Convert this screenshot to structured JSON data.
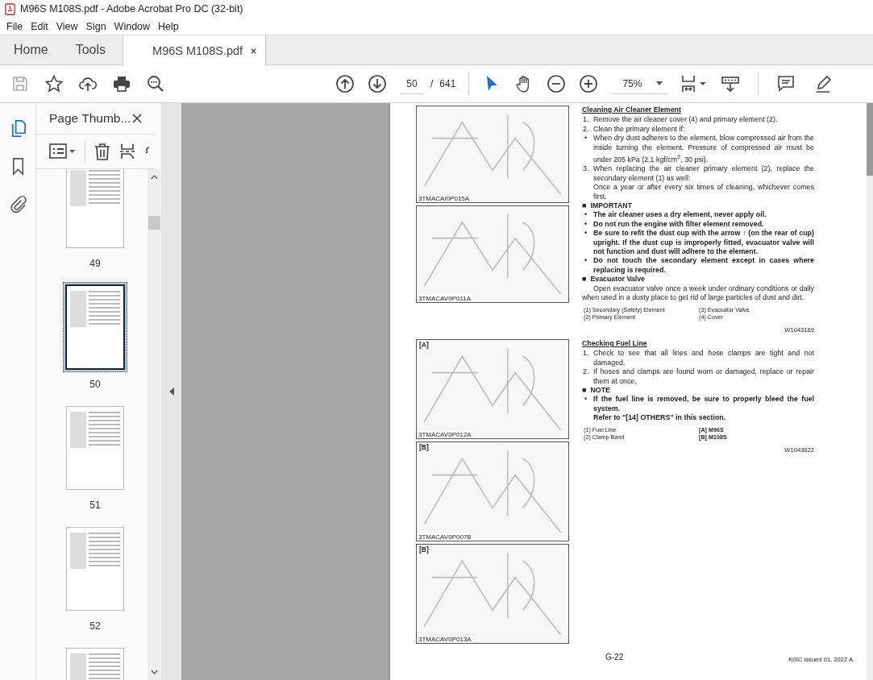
{
  "window": {
    "title": "M96S M108S.pdf - Adobe Acrobat Pro DC (32-bit)"
  },
  "menu": [
    "File",
    "Edit",
    "View",
    "Sign",
    "Window",
    "Help"
  ],
  "tabs": [
    {
      "label": "Home",
      "selected": false
    },
    {
      "label": "Tools",
      "selected": false
    },
    {
      "label": "M96S M108S.pdf",
      "selected": true
    }
  ],
  "toolbar": {
    "page_current": "50",
    "page_separator": "/",
    "page_total": "641",
    "zoom": "75%"
  },
  "sidebar": {
    "title": "Page Thumb...",
    "thumbnails": [
      {
        "label": "49",
        "selected": false
      },
      {
        "label": "50",
        "selected": true
      },
      {
        "label": "51",
        "selected": false
      },
      {
        "label": "52",
        "selected": false
      }
    ]
  },
  "page": {
    "sections": [
      {
        "figures": [
          {
            "caption": "3TMACAI0P015A"
          },
          {
            "caption": "3TMACAV0P011A"
          }
        ],
        "blocks": [
          {
            "kind": "heading",
            "text": "Cleaning Air Cleaner Element"
          },
          {
            "kind": "step",
            "marker": "1.",
            "text": "Remove the air cleaner cover (4) and primary element (2)."
          },
          {
            "kind": "step",
            "marker": "2.",
            "text": "Clean the primary element if:"
          },
          {
            "kind": "bullet",
            "marker": "•",
            "text": "When dry dust adheres to the element, blow compressed air from the inside turning the element. Pressure of compressed air must be under 205 kPa (2.1 kgf/cm$^{2}$, 30 psi)."
          },
          {
            "kind": "step",
            "marker": "3.",
            "text": "When replacing the air cleaner primary element (2), replace the secondary element (1) as well:"
          },
          {
            "kind": "indent",
            "text": "Once a year or after every six times of cleaning, whichever comes first."
          },
          {
            "kind": "label",
            "marker": "■",
            "text": "IMPORTANT"
          },
          {
            "kind": "warning",
            "marker": "•",
            "text": "The air cleaner uses a dry element, never apply oil."
          },
          {
            "kind": "warning",
            "marker": "•",
            "text": "Do not run the engine with filter element removed."
          },
          {
            "kind": "warning",
            "marker": "•",
            "text": "Be sure to refit the dust cup with the arrow ↑ (on the rear of cup) upright. If the dust cup is improperly fitted, evacuator valve will not function and dust will adhere to the element."
          },
          {
            "kind": "warning",
            "marker": "•",
            "text": "Do not touch the secondary element except in cases where replacing is required."
          },
          {
            "kind": "label",
            "marker": "■",
            "text": "Evacuator Valve"
          },
          {
            "kind": "para",
            "text": "Open evacuator valve once a week under ordinary conditions or daily when used in a dusty place to get rid of large particles of dust and dirt."
          },
          {
            "kind": "legend",
            "items": [
              {
                "text": "(1) Secondary (Safety) Element",
                "bold": false
              },
              {
                "text": "(3) Evacuator Valve",
                "bold": false
              },
              {
                "text": "(2) Primary Element",
                "bold": false
              },
              {
                "text": "(4) Cover",
                "bold": false
              }
            ]
          },
          {
            "kind": "ref",
            "text": "W1043169"
          }
        ]
      },
      {
        "figures": [
          {
            "tag": "[A]",
            "caption": "3TMACAV0P012A"
          },
          {
            "tag": "[B]",
            "caption": "3TMACAV0P007B"
          },
          {
            "tag": "[B]",
            "caption": "3TMACAV0P013A"
          }
        ],
        "blocks": [
          {
            "kind": "heading",
            "text": "Checking Fuel Line"
          },
          {
            "kind": "step",
            "marker": "1.",
            "text": "Check to see that all lines and hose clamps are tight and not damaged."
          },
          {
            "kind": "step",
            "marker": "2.",
            "text": "If hoses and clamps are found worn or damaged, replace or repair them at once."
          },
          {
            "kind": "label",
            "marker": "■",
            "text": "NOTE"
          },
          {
            "kind": "warning",
            "marker": "•",
            "text": "If the fuel line is removed, be sure to properly bleed the fuel system."
          },
          {
            "kind": "warning-indent",
            "text": "Refer to \"[14] OTHERS\" in this section."
          },
          {
            "kind": "legend",
            "items": [
              {
                "text": "(1) Fuel Line",
                "bold": false
              },
              {
                "text": "[A] M96S",
                "bold": true
              },
              {
                "text": "(2) Clamp Band",
                "bold": false
              },
              {
                "text": "[B] M108S",
                "bold": true
              }
            ]
          },
          {
            "kind": "ref",
            "text": "W1043622"
          }
        ]
      }
    ],
    "footer": {
      "page_number": "G-22",
      "issue": "KiSC issued 01, 2022 A"
    }
  }
}
